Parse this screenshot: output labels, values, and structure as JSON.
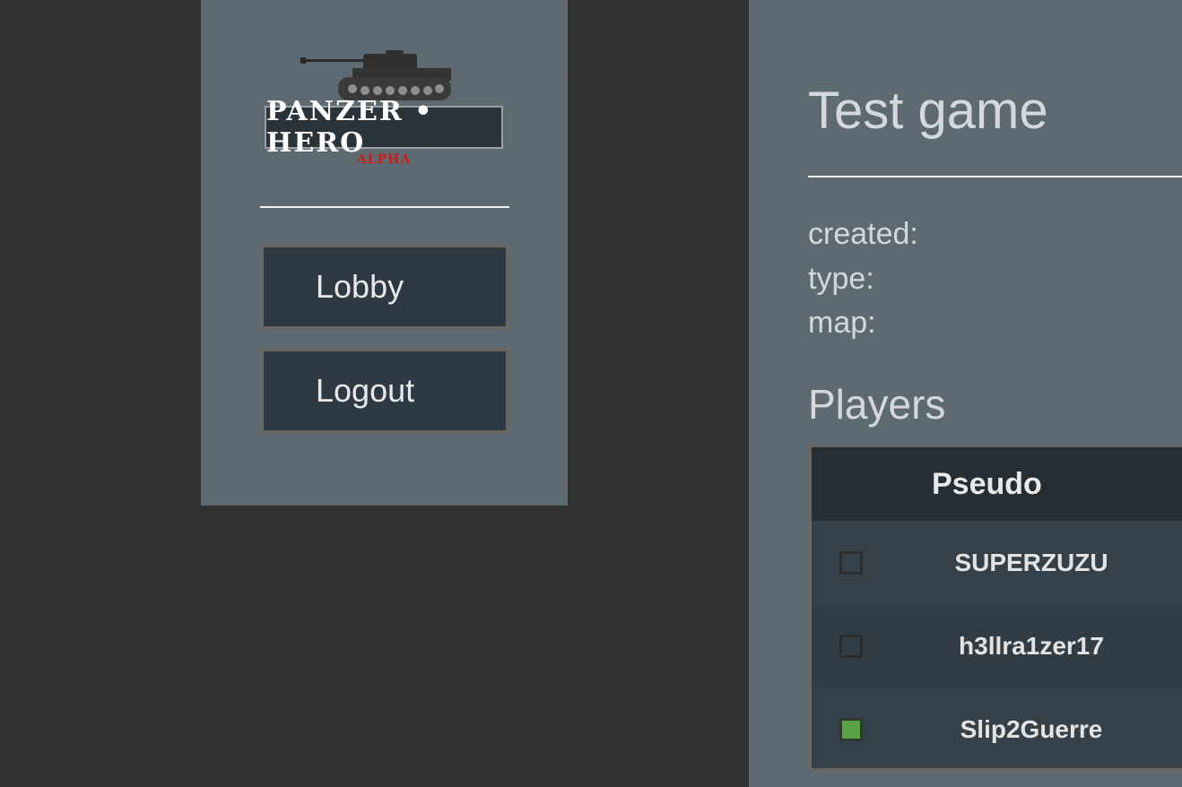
{
  "logo": {
    "text": "PANZER • HERO",
    "subtitle": "ALPHA"
  },
  "sidebar": {
    "buttons": [
      {
        "label": "Lobby"
      },
      {
        "label": "Logout"
      }
    ]
  },
  "game": {
    "title": "Test game",
    "info": {
      "created_label": "created:",
      "type_label": "type:",
      "map_label": "map:"
    },
    "players_heading": "Players",
    "table_header": "Pseudo",
    "players": [
      {
        "name": "SUPERZUZU",
        "ready": false
      },
      {
        "name": "h3llra1zer17",
        "ready": false
      },
      {
        "name": "Slip2Guerre",
        "ready": true
      }
    ]
  },
  "colors": {
    "background": "#323232",
    "panel": "#5d6a72",
    "button": "#2f3944",
    "ready_green": "#5aa24a",
    "logo_red": "#c81e1e"
  }
}
